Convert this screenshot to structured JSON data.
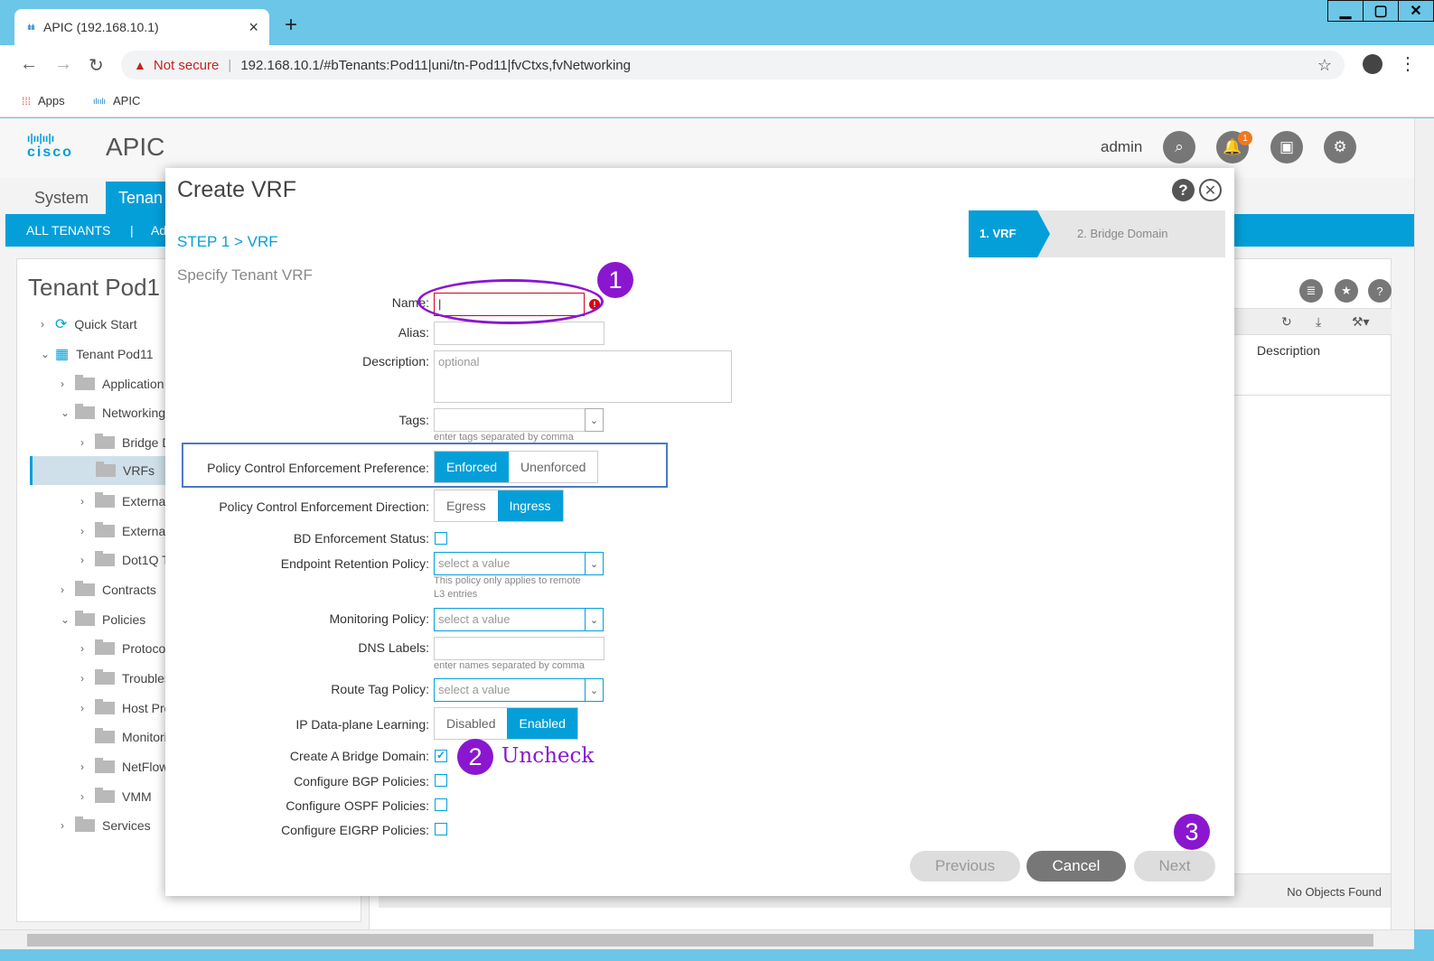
{
  "browser": {
    "tab_title": "APIC (192.168.10.1)",
    "tab_close": "×",
    "new_tab": "+",
    "security_label": "Not secure",
    "url": "192.168.10.1/#bTenants:Pod11|uni/tn-Pod11|fvCtxs,fvNetworking",
    "bookmarks": [
      {
        "label": "Apps",
        "icon": "apps-grid-icon"
      },
      {
        "label": "APIC",
        "icon": "cisco-icon"
      }
    ]
  },
  "apic": {
    "logo_text": "cisco",
    "title": "APIC",
    "user": "admin",
    "notification_count": "1",
    "top_tabs": [
      "System",
      "Tenan"
    ],
    "sub_nav": [
      "ALL TENANTS",
      "|",
      "Ad"
    ]
  },
  "left_panel": {
    "title": "Tenant Pod1",
    "tree": [
      {
        "label": "Quick Start"
      },
      {
        "label": "Tenant Pod11"
      },
      {
        "label": "Application"
      },
      {
        "label": "Networking"
      },
      {
        "label": "Bridge D"
      },
      {
        "label": "VRFs"
      },
      {
        "label": "External"
      },
      {
        "label": "External"
      },
      {
        "label": "Dot1Q T"
      },
      {
        "label": "Contracts"
      },
      {
        "label": "Policies"
      },
      {
        "label": "Protoco"
      },
      {
        "label": "Troubles"
      },
      {
        "label": "Host Pro"
      },
      {
        "label": "Monitori"
      },
      {
        "label": "NetFlow"
      },
      {
        "label": "VMM"
      },
      {
        "label": "Services"
      }
    ]
  },
  "right_panel": {
    "column_description": "Description",
    "no_objects": "No Objects Found"
  },
  "modal": {
    "title": "Create VRF",
    "step": "STEP 1 > VRF",
    "subtitle": "Specify Tenant VRF",
    "wizard_steps": [
      "1. VRF",
      "2. Bridge Domain"
    ],
    "fields": {
      "name_label": "Name:",
      "name_value": "|",
      "alias_label": "Alias:",
      "description_label": "Description:",
      "description_placeholder": "optional",
      "tags_label": "Tags:",
      "tags_hint": "enter tags separated by comma",
      "pce_pref_label": "Policy Control Enforcement Preference:",
      "pce_pref_options": [
        "Enforced",
        "Unenforced"
      ],
      "pce_pref_selected": "Enforced",
      "pce_dir_label": "Policy Control Enforcement Direction:",
      "pce_dir_options": [
        "Egress",
        "Ingress"
      ],
      "pce_dir_selected": "Ingress",
      "bd_enf_label": "BD Enforcement Status:",
      "endpoint_label": "Endpoint Retention Policy:",
      "endpoint_placeholder": "select a value",
      "endpoint_hint_1": "This policy only applies to remote",
      "endpoint_hint_2": "L3 entries",
      "monitoring_label": "Monitoring Policy:",
      "monitoring_placeholder": "select a value",
      "dns_label": "DNS Labels:",
      "dns_hint": "enter names separated by comma",
      "route_tag_label": "Route Tag Policy:",
      "route_tag_placeholder": "select a value",
      "ip_learning_label": "IP Data-plane Learning:",
      "ip_learning_options": [
        "Disabled",
        "Enabled"
      ],
      "ip_learning_selected": "Enabled",
      "create_bd_label": "Create A Bridge Domain:",
      "create_bd_checked": true,
      "bgp_label": "Configure BGP Policies:",
      "ospf_label": "Configure OSPF Policies:",
      "eigrp_label": "Configure EIGRP Policies:"
    },
    "buttons": {
      "previous": "Previous",
      "cancel": "Cancel",
      "next": "Next"
    }
  },
  "annotations": {
    "marker_1": "1",
    "marker_2": "2",
    "marker_3": "3",
    "note_2": "Uncheck",
    "color": "#8a17cf"
  }
}
